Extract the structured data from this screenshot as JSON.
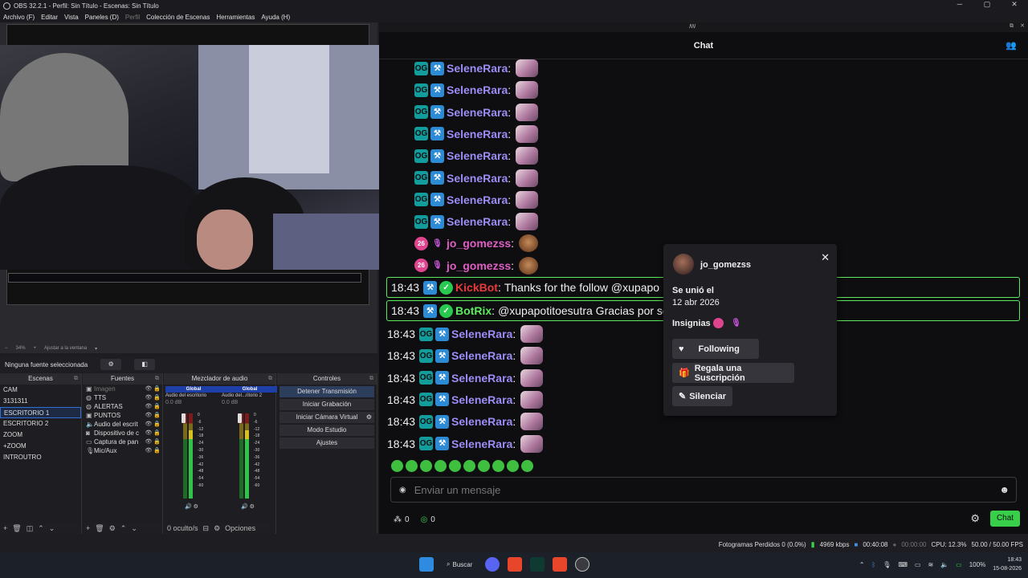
{
  "window": {
    "title": "OBS 32.2.1 - Perfil: Sin Título - Escenas: Sin Título",
    "controls": [
      "─",
      "▢",
      "✕"
    ]
  },
  "menu": [
    "Archivo (F)",
    "Editar",
    "Vista",
    "Paneles (D)",
    "Perfil",
    "Colección de Escenas",
    "Herramientas",
    "Ayuda (H)"
  ],
  "preview": {
    "zoom": "34%",
    "fit_label": "Ajustar a la ventana"
  },
  "no_source_label": "Ninguna fuente seleccionada",
  "docks": {
    "scenes_title": "Escenas",
    "sources_title": "Fuentes",
    "mixer_title": "Mezclador de audio",
    "controls_title": "Controles"
  },
  "scenes": [
    "CAM",
    "3131311",
    "ESCRITORIO 1",
    "ESCRITORIO 2",
    "ZOOM",
    "+ZOOM",
    "INTROUTRO"
  ],
  "selected_scene_index": 2,
  "sources": [
    {
      "name": "Imagen",
      "icon": "image-icon",
      "dim": true
    },
    {
      "name": "TTS",
      "icon": "globe-icon",
      "dim": false
    },
    {
      "name": "ALERTAS",
      "icon": "globe-icon",
      "dim": false
    },
    {
      "name": "PUNTOS",
      "icon": "image-icon",
      "dim": false
    },
    {
      "name": "Audio del escrit",
      "icon": "speaker-icon",
      "dim": false
    },
    {
      "name": "Dispositivo de c",
      "icon": "camera-icon",
      "dim": false
    },
    {
      "name": "Captura de pan",
      "icon": "monitor-icon",
      "dim": false
    },
    {
      "name": "Mic/Aux",
      "icon": "mic-icon",
      "dim": false
    }
  ],
  "mixer": {
    "channels": [
      {
        "tag": "Global",
        "name": "Audio del escritorio",
        "db": "0.0 dB"
      },
      {
        "tag": "Global",
        "name": "Audio del...ritorio 2",
        "db": "0.0 dB"
      }
    ],
    "scale": [
      "0",
      "-6",
      "-12",
      "-18",
      "-24",
      "-30",
      "-36",
      "-42",
      "-48",
      "-54",
      "-60"
    ],
    "hidden": "0 oculto/s",
    "options": "Opciones"
  },
  "controls": {
    "stop_stream": "Detener Transmisión",
    "start_recording": "Iniciar Grabación",
    "start_virtual_cam": "Iniciar Cámara Virtual",
    "studio_mode": "Modo Estudio",
    "settings": "Ajustes"
  },
  "chat": {
    "title": "Chat",
    "popout_icon": "ꟿ",
    "messages": [
      {
        "time": "",
        "badges": [
          "og",
          "mod"
        ],
        "user": "SeleneRara",
        "color": "#9b8df5",
        "text": "",
        "emote": "pink"
      },
      {
        "time": "",
        "badges": [
          "og",
          "mod"
        ],
        "user": "SeleneRara",
        "color": "#9b8df5",
        "text": "",
        "emote": "pink"
      },
      {
        "time": "",
        "badges": [
          "og",
          "mod"
        ],
        "user": "SeleneRara",
        "color": "#9b8df5",
        "text": "",
        "emote": "pink"
      },
      {
        "time": "",
        "badges": [
          "og",
          "mod"
        ],
        "user": "SeleneRara",
        "color": "#9b8df5",
        "text": "",
        "emote": "pink"
      },
      {
        "time": "",
        "badges": [
          "og",
          "mod"
        ],
        "user": "SeleneRara",
        "color": "#9b8df5",
        "text": "",
        "emote": "pink"
      },
      {
        "time": "",
        "badges": [
          "og",
          "mod"
        ],
        "user": "SeleneRara",
        "color": "#9b8df5",
        "text": "",
        "emote": "pink"
      },
      {
        "time": "",
        "badges": [
          "og",
          "mod"
        ],
        "user": "SeleneRara",
        "color": "#9b8df5",
        "text": "",
        "emote": "pink"
      },
      {
        "time": "",
        "badges": [
          "og",
          "mod"
        ],
        "user": "SeleneRara",
        "color": "#9b8df5",
        "text": "",
        "emote": "pink"
      },
      {
        "time": "",
        "badges": [
          "sub",
          "mic"
        ],
        "user": "jo_gomezss",
        "color": "#e05ec4",
        "text": "",
        "emote": "brown"
      },
      {
        "time": "",
        "badges": [
          "sub",
          "mic"
        ],
        "user": "jo_gomezss",
        "color": "#e05ec4",
        "text": "",
        "emote": "brown"
      },
      {
        "time": "18:43",
        "badges": [
          "mod",
          "ver"
        ],
        "user": "KickBot",
        "color": "#e83a3a",
        "text": "Thanks for the follow @xupapo",
        "emote": "",
        "highlight": true
      },
      {
        "time": "18:43",
        "badges": [
          "mod",
          "ver"
        ],
        "user": "BotRix",
        "color": "#5eea5e",
        "text": "@xupapotitoesutra Gracias por se",
        "emote": "",
        "highlight": true
      },
      {
        "time": "18:43",
        "badges": [
          "og",
          "mod"
        ],
        "user": "SeleneRara",
        "color": "#9b8df5",
        "text": "",
        "emote": "pink"
      },
      {
        "time": "18:43",
        "badges": [
          "og",
          "mod"
        ],
        "user": "SeleneRara",
        "color": "#9b8df5",
        "text": "",
        "emote": "pink"
      },
      {
        "time": "18:43",
        "badges": [
          "og",
          "mod"
        ],
        "user": "SeleneRara",
        "color": "#9b8df5",
        "text": "",
        "emote": "pink"
      },
      {
        "time": "18:43",
        "badges": [
          "og",
          "mod"
        ],
        "user": "SeleneRara",
        "color": "#9b8df5",
        "text": "",
        "emote": "pink"
      },
      {
        "time": "18:43",
        "badges": [
          "og",
          "mod"
        ],
        "user": "SeleneRara",
        "color": "#9b8df5",
        "text": "",
        "emote": "pink"
      },
      {
        "time": "18:43",
        "badges": [
          "og",
          "mod"
        ],
        "user": "SeleneRara",
        "color": "#9b8df5",
        "text": "",
        "emote": "pink"
      }
    ],
    "input_placeholder": "Enviar un mensaje",
    "points_a": "0",
    "points_b": "0",
    "send_label": "Chat"
  },
  "user_popup": {
    "username": "jo_gomezss",
    "joined_label": "Se unió el",
    "joined_date": "12 abr 2026",
    "badges_label": "Insignias",
    "following_label": "Following",
    "gift_label": "Regala una Suscripción",
    "mute_label": "Silenciar"
  },
  "status": {
    "dropped_frames": "Fotogramas Perdidos 0 (0.0%)",
    "bitrate": "4969 kbps",
    "live_time": "00:40:08",
    "rec_time": "00:00:00",
    "cpu": "CPU: 12.3%",
    "fps": "50.00 / 50.00 FPS"
  },
  "taskbar": {
    "search_label": "Buscar",
    "battery": "100%",
    "time": "18:43",
    "date": "15-08-2026"
  },
  "colors": {
    "accent_green": "#38d04a",
    "kick_bg": "#0e0e10",
    "obs_bg": "#1e1e22"
  }
}
